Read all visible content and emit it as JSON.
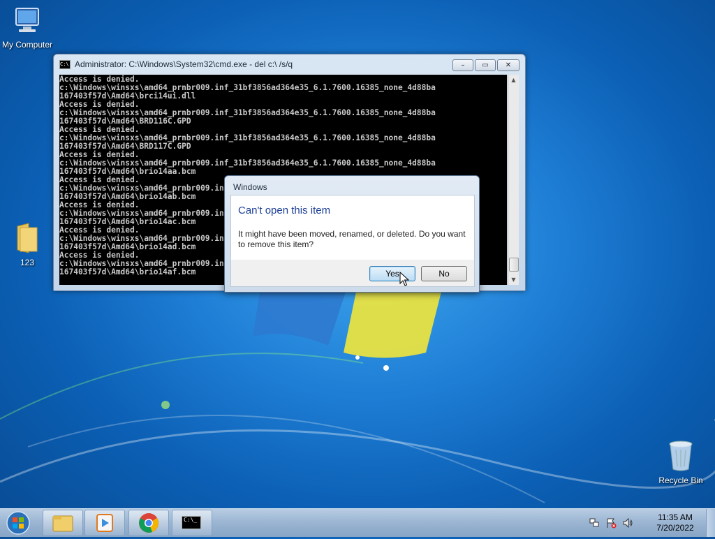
{
  "desktop": {
    "icons": [
      {
        "label": "My Computer"
      },
      {
        "label": "123"
      },
      {
        "label": "Recycle Bin"
      }
    ]
  },
  "cmd_window": {
    "title": "Administrator: C:\\Windows\\System32\\cmd.exe - del  c:\\ /s/q",
    "icon_label": "C:\\",
    "lines": [
      "Access is denied.",
      "c:\\Windows\\winsxs\\amd64_prnbr009.inf_31bf3856ad364e35_6.1.7600.16385_none_4d88ba",
      "167403f57d\\Amd64\\brci14ui.dll",
      "Access is denied.",
      "c:\\Windows\\winsxs\\amd64_prnbr009.inf_31bf3856ad364e35_6.1.7600.16385_none_4d88ba",
      "167403f57d\\Amd64\\BRD116C.GPD",
      "Access is denied.",
      "c:\\Windows\\winsxs\\amd64_prnbr009.inf_31bf3856ad364e35_6.1.7600.16385_none_4d88ba",
      "167403f57d\\Amd64\\BRD117C.GPD",
      "Access is denied.",
      "c:\\Windows\\winsxs\\amd64_prnbr009.inf_31bf3856ad364e35_6.1.7600.16385_none_4d88ba",
      "167403f57d\\Amd64\\brio14aa.bcm",
      "Access is denied.",
      "c:\\Windows\\winsxs\\amd64_prnbr009.inf_31bf3856ad364e35_6.1.7600.16385_none_4d88ba",
      "167403f57d\\Amd64\\brio14ab.bcm",
      "Access is denied.",
      "c:\\Windows\\winsxs\\amd64_prnbr009.inf_31bf3856ad364e35_6.1.7600.16385_none_4d88ba",
      "167403f57d\\Amd64\\brio14ac.bcm",
      "Access is denied.",
      "c:\\Windows\\winsxs\\amd64_prnbr009.inf_31bf3856ad364e35_6.1.7600.16385_none_4d88ba",
      "167403f57d\\Amd64\\brio14ad.bcm",
      "Access is denied.",
      "c:\\Windows\\winsxs\\amd64_prnbr009.inf_31bf3856ad364e35_6.1.7600.16385_none_4d88ba",
      "167403f57d\\Amd64\\brio14af.bcm"
    ],
    "controls": {
      "minimize": "–",
      "maximize": "▭",
      "close": "✕"
    }
  },
  "dialog": {
    "title": "Windows",
    "heading": "Can't open this item",
    "message": "It might have been moved, renamed, or deleted. Do you want to remove this item?",
    "yes_label": "Yes",
    "no_label": "No"
  },
  "taskbar": {
    "cmd_icon_label": "C:\\_",
    "clock_time": "11:35 AM",
    "clock_date": "7/20/2022"
  },
  "colors": {
    "desktop_bg": "#1f7fd6",
    "dialog_heading": "#1c3f95",
    "console_bg": "#000000",
    "console_text": "#c8c8c8"
  }
}
